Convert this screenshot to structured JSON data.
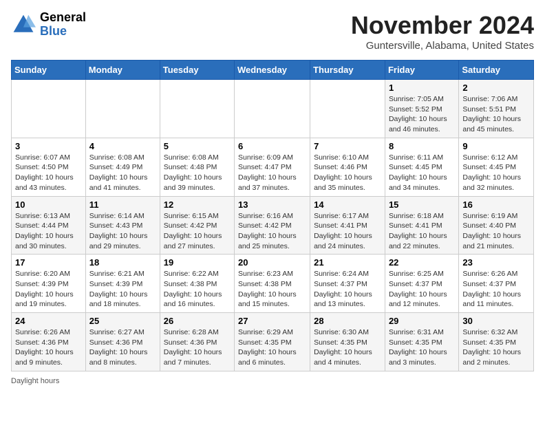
{
  "app": {
    "name": "GeneralBlue",
    "logo_line1": "General",
    "logo_line2": "Blue"
  },
  "title": "November 2024",
  "subtitle": "Guntersville, Alabama, United States",
  "weekdays": [
    "Sunday",
    "Monday",
    "Tuesday",
    "Wednesday",
    "Thursday",
    "Friday",
    "Saturday"
  ],
  "weeks": [
    [
      {
        "day": "",
        "info": ""
      },
      {
        "day": "",
        "info": ""
      },
      {
        "day": "",
        "info": ""
      },
      {
        "day": "",
        "info": ""
      },
      {
        "day": "",
        "info": ""
      },
      {
        "day": "1",
        "info": "Sunrise: 7:05 AM\nSunset: 5:52 PM\nDaylight: 10 hours and 46 minutes."
      },
      {
        "day": "2",
        "info": "Sunrise: 7:06 AM\nSunset: 5:51 PM\nDaylight: 10 hours and 45 minutes."
      }
    ],
    [
      {
        "day": "3",
        "info": "Sunrise: 6:07 AM\nSunset: 4:50 PM\nDaylight: 10 hours and 43 minutes."
      },
      {
        "day": "4",
        "info": "Sunrise: 6:08 AM\nSunset: 4:49 PM\nDaylight: 10 hours and 41 minutes."
      },
      {
        "day": "5",
        "info": "Sunrise: 6:08 AM\nSunset: 4:48 PM\nDaylight: 10 hours and 39 minutes."
      },
      {
        "day": "6",
        "info": "Sunrise: 6:09 AM\nSunset: 4:47 PM\nDaylight: 10 hours and 37 minutes."
      },
      {
        "day": "7",
        "info": "Sunrise: 6:10 AM\nSunset: 4:46 PM\nDaylight: 10 hours and 35 minutes."
      },
      {
        "day": "8",
        "info": "Sunrise: 6:11 AM\nSunset: 4:45 PM\nDaylight: 10 hours and 34 minutes."
      },
      {
        "day": "9",
        "info": "Sunrise: 6:12 AM\nSunset: 4:45 PM\nDaylight: 10 hours and 32 minutes."
      }
    ],
    [
      {
        "day": "10",
        "info": "Sunrise: 6:13 AM\nSunset: 4:44 PM\nDaylight: 10 hours and 30 minutes."
      },
      {
        "day": "11",
        "info": "Sunrise: 6:14 AM\nSunset: 4:43 PM\nDaylight: 10 hours and 29 minutes."
      },
      {
        "day": "12",
        "info": "Sunrise: 6:15 AM\nSunset: 4:42 PM\nDaylight: 10 hours and 27 minutes."
      },
      {
        "day": "13",
        "info": "Sunrise: 6:16 AM\nSunset: 4:42 PM\nDaylight: 10 hours and 25 minutes."
      },
      {
        "day": "14",
        "info": "Sunrise: 6:17 AM\nSunset: 4:41 PM\nDaylight: 10 hours and 24 minutes."
      },
      {
        "day": "15",
        "info": "Sunrise: 6:18 AM\nSunset: 4:41 PM\nDaylight: 10 hours and 22 minutes."
      },
      {
        "day": "16",
        "info": "Sunrise: 6:19 AM\nSunset: 4:40 PM\nDaylight: 10 hours and 21 minutes."
      }
    ],
    [
      {
        "day": "17",
        "info": "Sunrise: 6:20 AM\nSunset: 4:39 PM\nDaylight: 10 hours and 19 minutes."
      },
      {
        "day": "18",
        "info": "Sunrise: 6:21 AM\nSunset: 4:39 PM\nDaylight: 10 hours and 18 minutes."
      },
      {
        "day": "19",
        "info": "Sunrise: 6:22 AM\nSunset: 4:38 PM\nDaylight: 10 hours and 16 minutes."
      },
      {
        "day": "20",
        "info": "Sunrise: 6:23 AM\nSunset: 4:38 PM\nDaylight: 10 hours and 15 minutes."
      },
      {
        "day": "21",
        "info": "Sunrise: 6:24 AM\nSunset: 4:37 PM\nDaylight: 10 hours and 13 minutes."
      },
      {
        "day": "22",
        "info": "Sunrise: 6:25 AM\nSunset: 4:37 PM\nDaylight: 10 hours and 12 minutes."
      },
      {
        "day": "23",
        "info": "Sunrise: 6:26 AM\nSunset: 4:37 PM\nDaylight: 10 hours and 11 minutes."
      }
    ],
    [
      {
        "day": "24",
        "info": "Sunrise: 6:26 AM\nSunset: 4:36 PM\nDaylight: 10 hours and 9 minutes."
      },
      {
        "day": "25",
        "info": "Sunrise: 6:27 AM\nSunset: 4:36 PM\nDaylight: 10 hours and 8 minutes."
      },
      {
        "day": "26",
        "info": "Sunrise: 6:28 AM\nSunset: 4:36 PM\nDaylight: 10 hours and 7 minutes."
      },
      {
        "day": "27",
        "info": "Sunrise: 6:29 AM\nSunset: 4:35 PM\nDaylight: 10 hours and 6 minutes."
      },
      {
        "day": "28",
        "info": "Sunrise: 6:30 AM\nSunset: 4:35 PM\nDaylight: 10 hours and 4 minutes."
      },
      {
        "day": "29",
        "info": "Sunrise: 6:31 AM\nSunset: 4:35 PM\nDaylight: 10 hours and 3 minutes."
      },
      {
        "day": "30",
        "info": "Sunrise: 6:32 AM\nSunset: 4:35 PM\nDaylight: 10 hours and 2 minutes."
      }
    ]
  ],
  "footer": "Daylight hours"
}
